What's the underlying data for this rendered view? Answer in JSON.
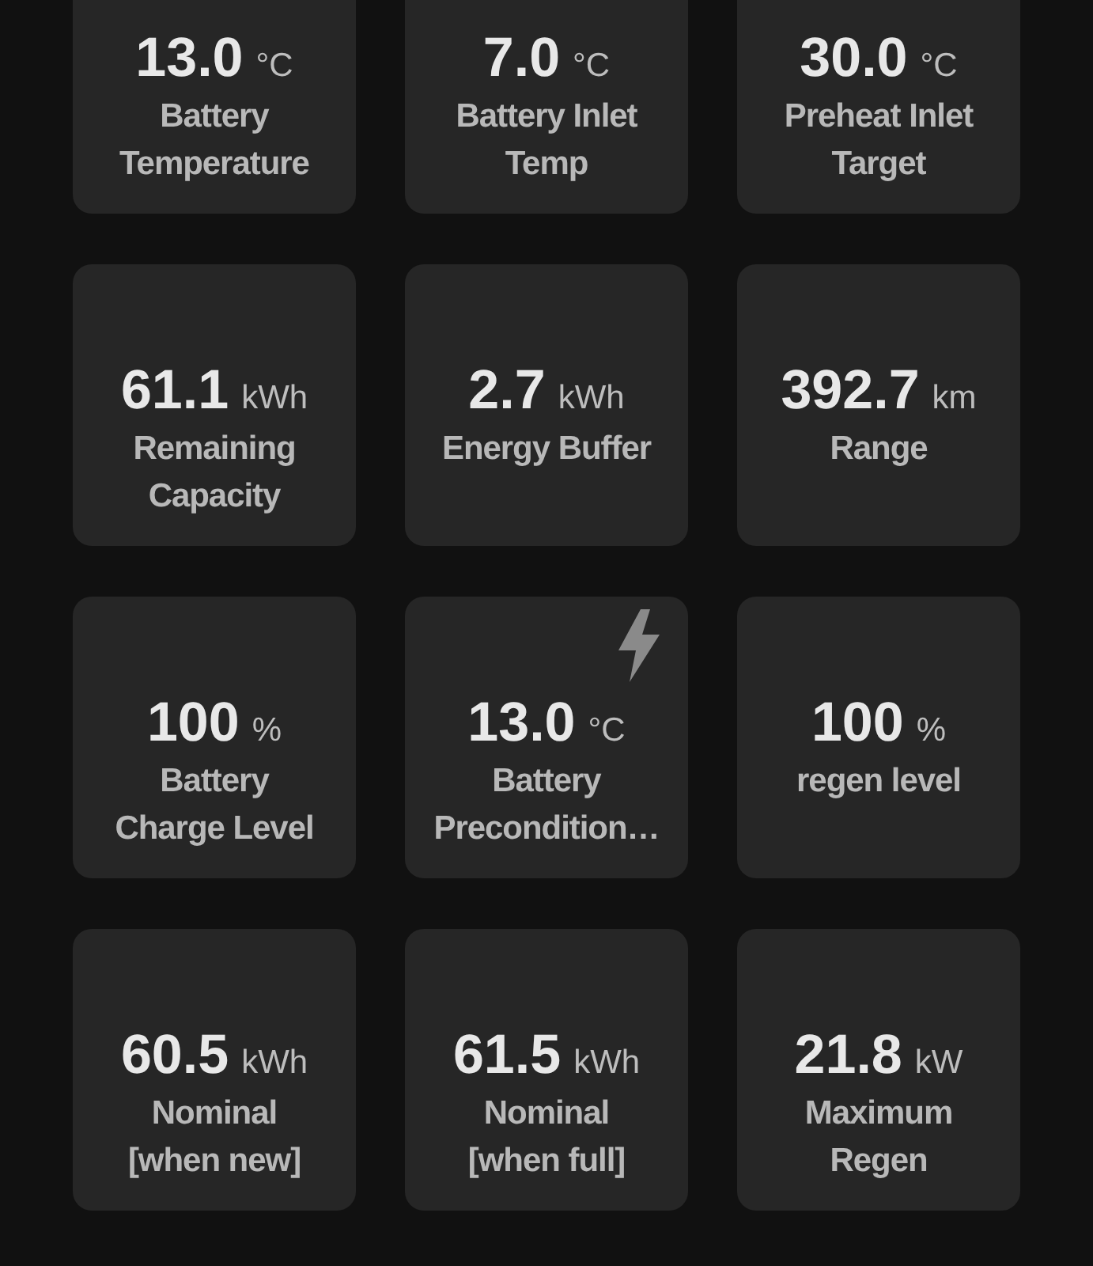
{
  "tiles": [
    {
      "value": "13.0",
      "unit": "°C",
      "label": "Battery\nTemperature"
    },
    {
      "value": "7.0",
      "unit": "°C",
      "label": "Battery Inlet\nTemp"
    },
    {
      "value": "30.0",
      "unit": "°C",
      "label": "Preheat Inlet\nTarget"
    },
    {
      "value": "61.1",
      "unit": "kWh",
      "label": "Remaining\nCapacity"
    },
    {
      "value": "2.7",
      "unit": "kWh",
      "label": "Energy Buffer"
    },
    {
      "value": "392.7",
      "unit": "km",
      "label": "Range"
    },
    {
      "value": "100",
      "unit": "%",
      "label": "Battery\nCharge Level"
    },
    {
      "value": "13.0",
      "unit": "°C",
      "label": "Battery\nPrecondition…",
      "kind": "flagged"
    },
    {
      "value": "100",
      "unit": "%",
      "label": "regen level"
    },
    {
      "value": "60.5",
      "unit": "kWh",
      "label": "Nominal\n[when new]"
    },
    {
      "value": "61.5",
      "unit": "kWh",
      "label": "Nominal\n[when full]"
    },
    {
      "value": "21.8",
      "unit": "kW",
      "label": "Maximum\nRegen"
    }
  ]
}
